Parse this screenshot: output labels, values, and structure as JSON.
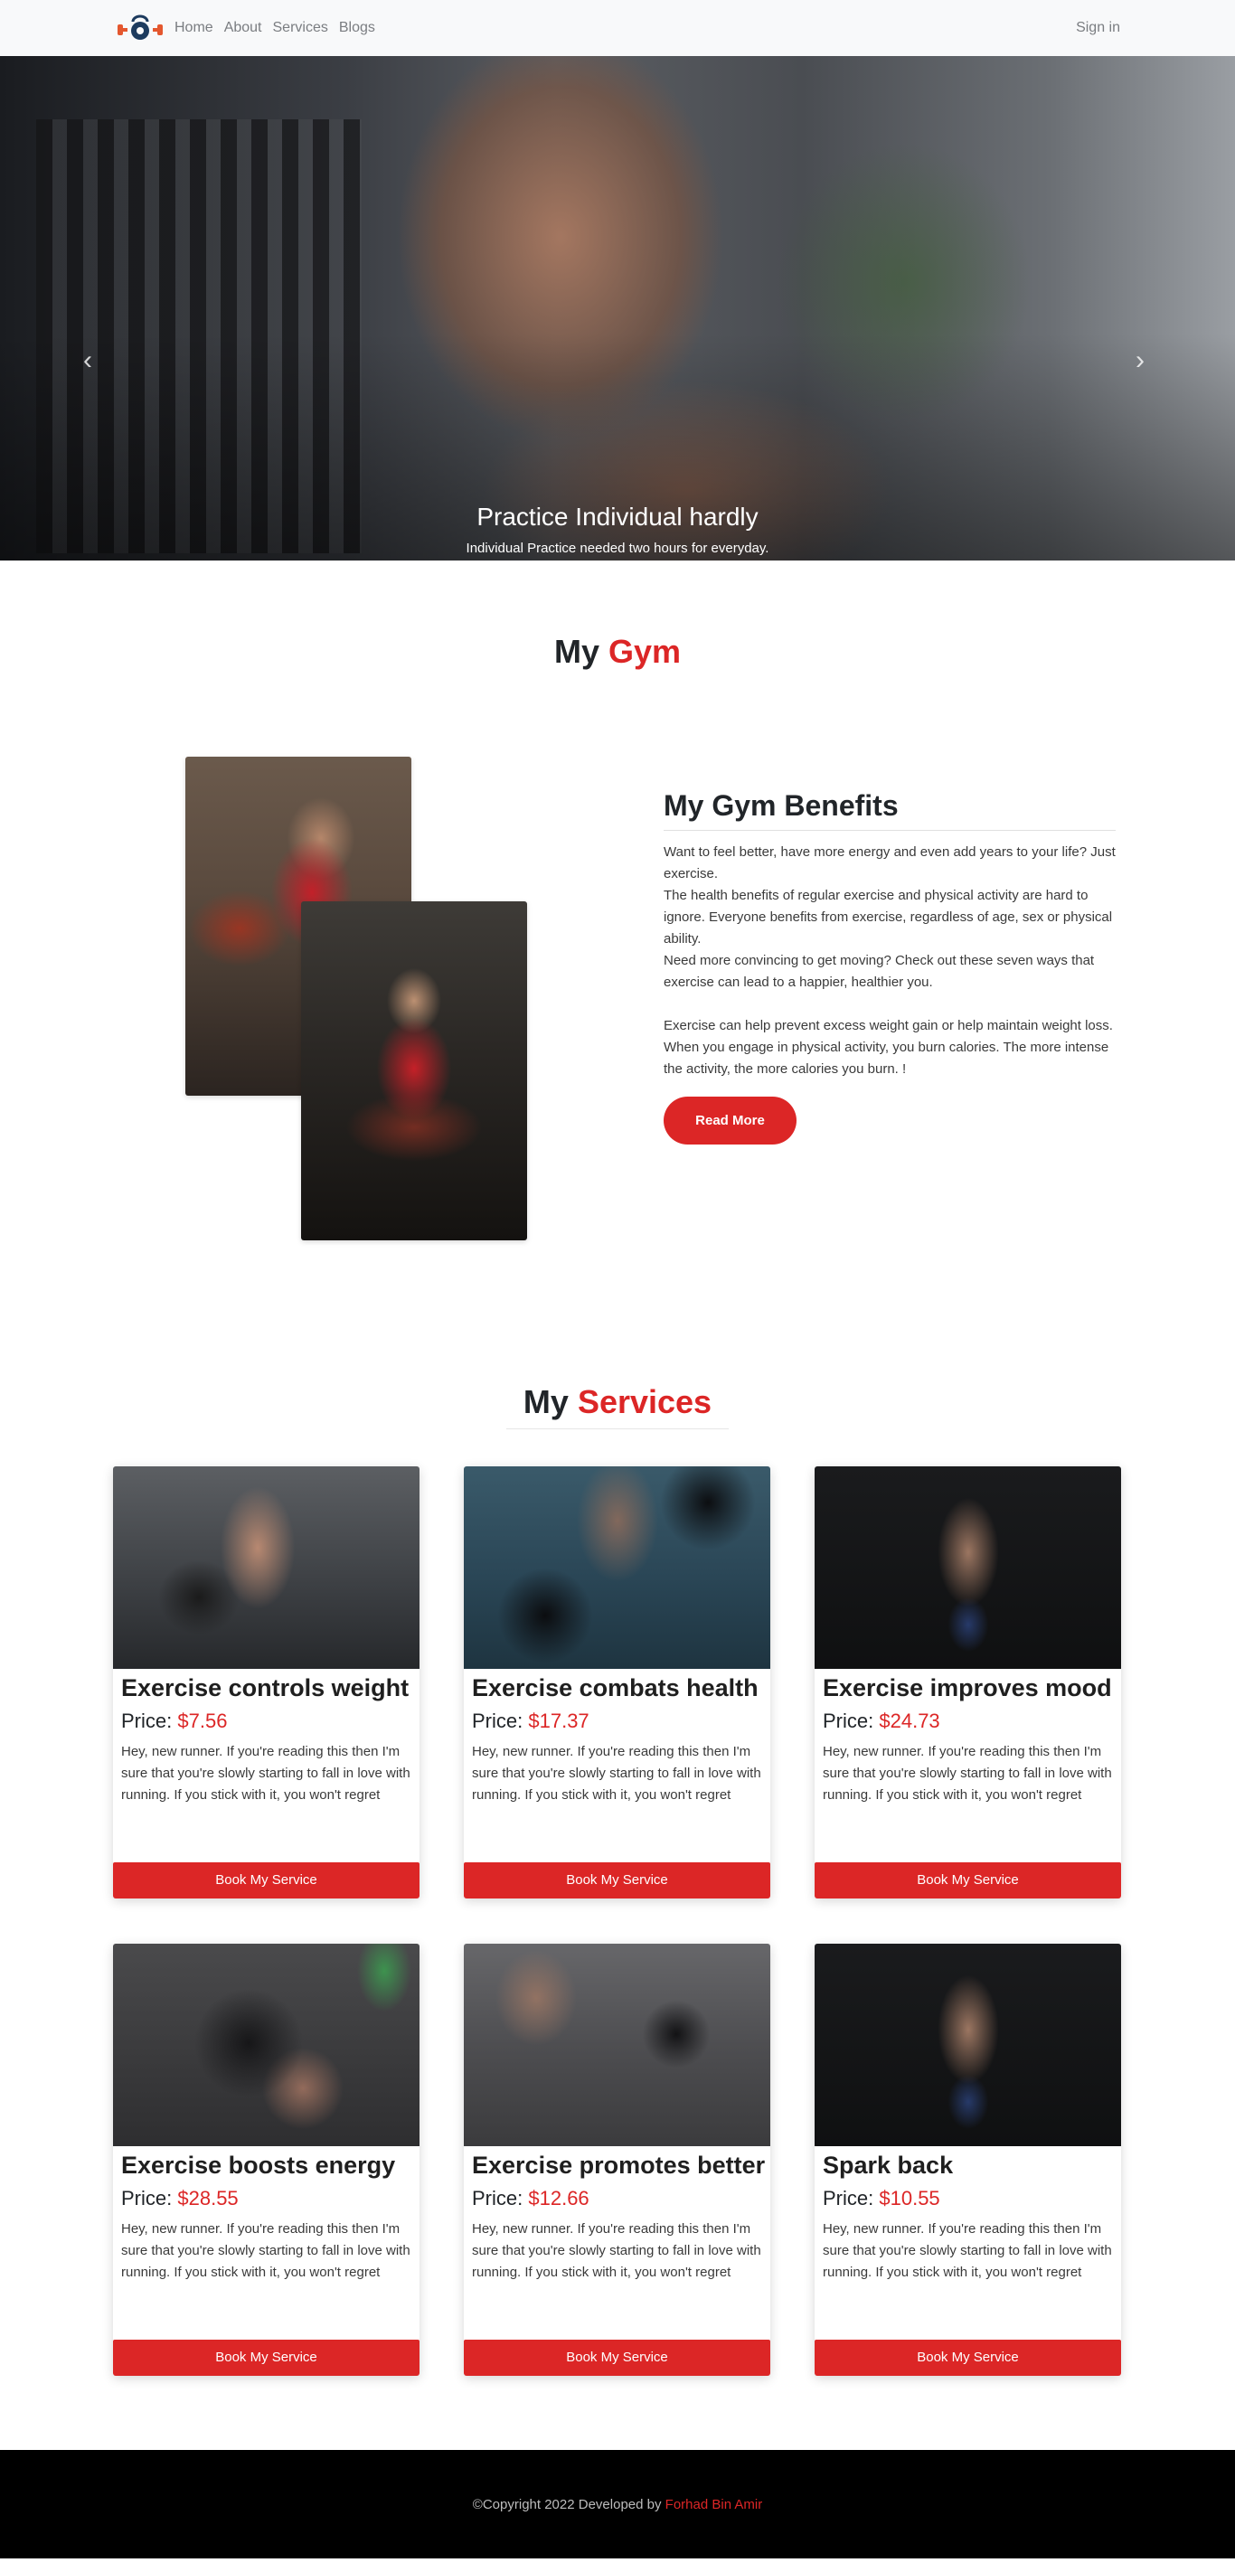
{
  "nav": {
    "brand_icon": "kettlebell-logo-icon",
    "links": [
      "Home",
      "About",
      "Services",
      "Blogs"
    ],
    "signin": "Sign in"
  },
  "hero": {
    "title": "Practice Individual hardly",
    "subtitle": "Individual Practice needed two hours for everyday.",
    "prev_icon": "chevron-left-icon",
    "next_icon": "chevron-right-icon",
    "slide_count": 3,
    "active_slide": 3
  },
  "about": {
    "title_prefix": "My",
    "title_accent": "Gym",
    "benefits_title": "My Gym Benefits",
    "paragraphs": [
      "Want to feel better, have more energy and even add years to your life? Just exercise.",
      "The health benefits of regular exercise and physical activity are hard to ignore. Everyone benefits from exercise, regardless of age, sex or physical ability.",
      "Need more convincing to get moving? Check out these seven ways that exercise can lead to a happier, healthier you.",
      "Exercise can help prevent excess weight gain or help maintain weight loss. When you engage in physical activity, you burn calories. The more intense the activity, the more calories you burn. !"
    ],
    "read_more": "Read More"
  },
  "services": {
    "title_prefix": "My",
    "title_accent": "Services",
    "price_label": "Price:",
    "button_label": "Book My Service",
    "description": "Hey, new runner. If you're reading this then I'm sure that you're slowly starting to fall in love with running. If you stick with it, you won't regret",
    "items": [
      {
        "title": "Exercise controls weight",
        "price": "$7.56"
      },
      {
        "title": "Exercise combats health",
        "price": "$17.37"
      },
      {
        "title": "Exercise improves mood",
        "price": "$24.73"
      },
      {
        "title": "Exercise boosts energy",
        "price": "$28.55"
      },
      {
        "title": "Exercise promotes better",
        "price": "$12.66"
      },
      {
        "title": "Spark back",
        "price": "$10.55"
      }
    ]
  },
  "footer": {
    "text": "©Copyright 2022 Developed by",
    "author": "Forhad Bin Amir"
  },
  "colors": {
    "accent": "#dc2626",
    "navbar_bg": "#f8f9fa",
    "footer_bg": "#000000"
  }
}
